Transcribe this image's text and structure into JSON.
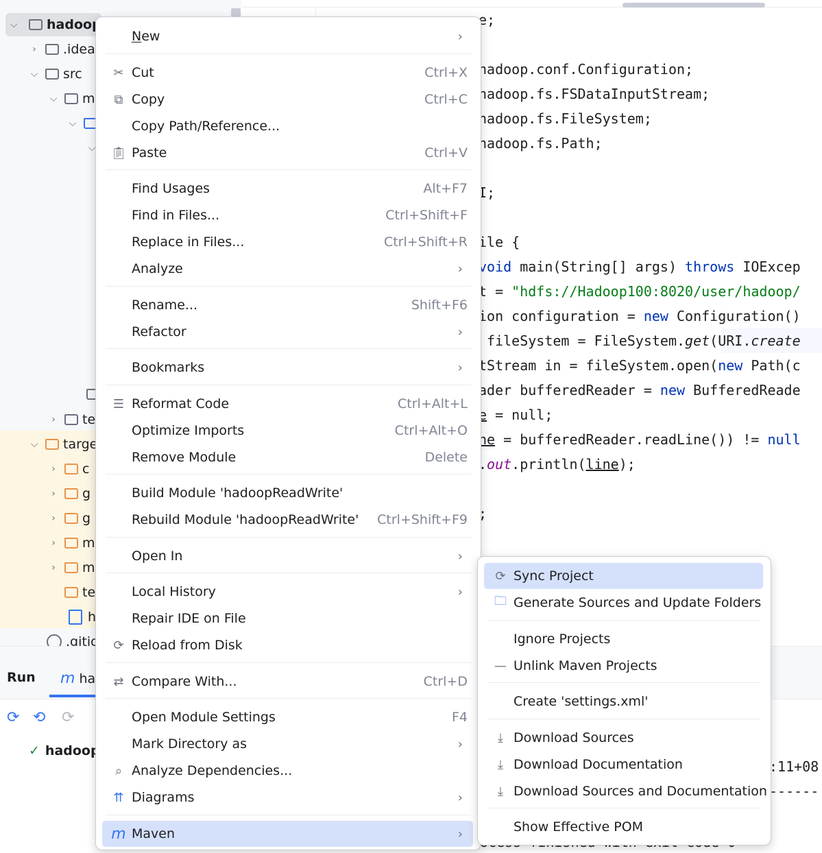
{
  "tree": {
    "rows": [
      {
        "label": "hadoop"
      },
      {
        "label": ".idea"
      },
      {
        "label": "src"
      },
      {
        "label": "m"
      },
      {
        "label": "te"
      },
      {
        "label": "targe"
      },
      {
        "label": "c"
      },
      {
        "label": "g"
      },
      {
        "label": "g"
      },
      {
        "label": "m"
      },
      {
        "label": "m"
      },
      {
        "label": "te"
      },
      {
        "label": "h"
      },
      {
        "label": ".gitig"
      }
    ]
  },
  "editor": {
    "lines": {
      "l1": "e;",
      "l2": "hadoop.conf.Configuration;",
      "l3": "hadoop.fs.FSDataInputStream;",
      "l4": "hadoop.fs.FileSystem;",
      "l5": "hadoop.fs.Path;",
      "l6": "I;",
      "l7": "ile {",
      "l8a": "void",
      "l8b": " main(String[] args) ",
      "l8c": "throws",
      "l8d": " IOExcep",
      "l9a": "t = ",
      "l9b": "\"hdfs://Hadoop100:8020/user/hadoop/",
      "l10a": "ion configuration = ",
      "l10b": "new",
      "l10c": " Configuration()",
      "l11a": " fileSystem = FileSystem.",
      "l11b": "get",
      "l11c": "(URI.",
      "l11d": "create",
      "l12a": "tStream in = fileSystem.open(",
      "l12b": "new",
      "l12c": " Path(c",
      "l13a": "ader bufferedReader = ",
      "l13b": "new",
      "l13c": " BufferedReade",
      "l14a": "e",
      "l14b": " = null;",
      "l15a": "ne",
      "l15b": " = bufferedReader.readLine()) != ",
      "l15c": "null",
      "l16a": ".",
      "l16b": "out",
      "l16c": ".println(",
      "l16d": "line",
      "l16e": ");",
      "l17": ";"
    }
  },
  "run_panel": {
    "title": "Run",
    "tab_icon": "m",
    "tab_label": "ha",
    "item_label": "hadoop",
    "console_line1": ":11+08",
    "console_line2": "------",
    "console_line3": "ocess finished with exit code 0"
  },
  "context_menu": {
    "items": {
      "new": "New",
      "cut": "Cut",
      "cut_sc": "Ctrl+X",
      "copy": "Copy",
      "copy_sc": "Ctrl+C",
      "copy_path": "Copy Path/Reference...",
      "paste": "Paste",
      "paste_sc": "Ctrl+V",
      "find_usages": "Find Usages",
      "find_usages_sc": "Alt+F7",
      "find_in_files": "Find in Files...",
      "find_in_files_sc": "Ctrl+Shift+F",
      "replace_in_files": "Replace in Files...",
      "replace_in_files_sc": "Ctrl+Shift+R",
      "analyze": "Analyze",
      "rename": "Rename...",
      "rename_sc": "Shift+F6",
      "refactor": "Refactor",
      "bookmarks": "Bookmarks",
      "reformat": "Reformat Code",
      "reformat_sc": "Ctrl+Alt+L",
      "optimize": "Optimize Imports",
      "optimize_sc": "Ctrl+Alt+O",
      "remove_module": "Remove Module",
      "remove_module_sc": "Delete",
      "build_module": "Build Module 'hadoopReadWrite'",
      "rebuild_module": "Rebuild Module 'hadoopReadWrite'",
      "rebuild_module_sc": "Ctrl+Shift+F9",
      "open_in": "Open In",
      "local_history": "Local History",
      "repair_ide": "Repair IDE on File",
      "reload": "Reload from Disk",
      "compare": "Compare With...",
      "compare_sc": "Ctrl+D",
      "module_settings": "Open Module Settings",
      "module_settings_sc": "F4",
      "mark_dir": "Mark Directory as",
      "analyze_deps": "Analyze Dependencies...",
      "diagrams": "Diagrams",
      "maven": "Maven"
    }
  },
  "maven_submenu": {
    "items": {
      "sync": "Sync Project",
      "generate": "Generate Sources and Update Folders",
      "ignore": "Ignore Projects",
      "unlink": "Unlink Maven Projects",
      "create_settings": "Create 'settings.xml'",
      "dl_sources": "Download Sources",
      "dl_docs": "Download Documentation",
      "dl_both": "Download Sources and Documentation",
      "effective_pom": "Show Effective POM"
    }
  },
  "colors": {
    "keyword": "#0033b3",
    "string": "#067d17",
    "highlight": "#d5e1fb",
    "target_band": "#fdf6e3"
  }
}
